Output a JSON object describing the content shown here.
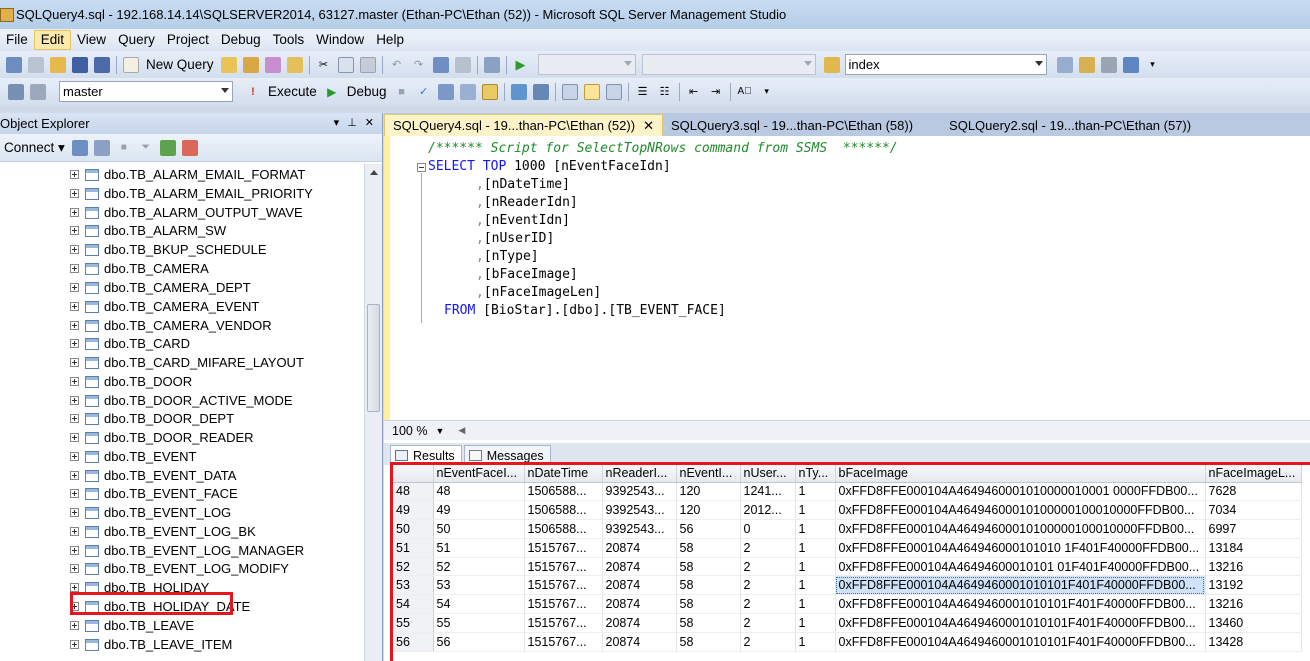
{
  "window": {
    "title": "SQLQuery4.sql - 192.168.14.14\\SQLSERVER2014, 63127.master (Ethan-PC\\Ethan (52)) - Microsoft SQL Server Management Studio"
  },
  "menu": {
    "items": [
      "File",
      "Edit",
      "View",
      "Query",
      "Project",
      "Debug",
      "Tools",
      "Window",
      "Help"
    ],
    "active": "Edit"
  },
  "toolbar1": {
    "new_query_label": "New Query",
    "search_value": "index"
  },
  "toolbar2": {
    "database_value": "master",
    "execute_label": "Execute",
    "debug_label": "Debug"
  },
  "object_explorer": {
    "title": "Object Explorer",
    "pin_glyph": "▾ ⊥ ✕",
    "connect_label": "Connect",
    "items": [
      "dbo.TB_ALARM_EMAIL_FORMAT",
      "dbo.TB_ALARM_EMAIL_PRIORITY",
      "dbo.TB_ALARM_OUTPUT_WAVE",
      "dbo.TB_ALARM_SW",
      "dbo.TB_BKUP_SCHEDULE",
      "dbo.TB_CAMERA",
      "dbo.TB_CAMERA_DEPT",
      "dbo.TB_CAMERA_EVENT",
      "dbo.TB_CAMERA_VENDOR",
      "dbo.TB_CARD",
      "dbo.TB_CARD_MIFARE_LAYOUT",
      "dbo.TB_DOOR",
      "dbo.TB_DOOR_ACTIVE_MODE",
      "dbo.TB_DOOR_DEPT",
      "dbo.TB_DOOR_READER",
      "dbo.TB_EVENT",
      "dbo.TB_EVENT_DATA",
      "dbo.TB_EVENT_FACE",
      "dbo.TB_EVENT_LOG",
      "dbo.TB_EVENT_LOG_BK",
      "dbo.TB_EVENT_LOG_MANAGER",
      "dbo.TB_EVENT_LOG_MODIFY",
      "dbo.TB_HOLIDAY",
      "dbo.TB_HOLIDAY_DATE",
      "dbo.TB_LEAVE",
      "dbo.TB_LEAVE_ITEM"
    ],
    "highlighted_item": "dbo.TB_EVENT_FACE"
  },
  "tabs": [
    {
      "label": "SQLQuery4.sql - 19...than-PC\\Ethan (52))",
      "active": true,
      "close": "✕"
    },
    {
      "label": "SQLQuery3.sql - 19...than-PC\\Ethan (58))",
      "active": false
    },
    {
      "label": "SQLQuery2.sql - 19...than-PC\\Ethan (57))",
      "active": false
    }
  ],
  "editor": {
    "comment": "/****** Script for SelectTopNRows command from SSMS  ******/",
    "select_kw": "SELECT",
    "top_kw": "TOP",
    "top_value": "1000",
    "first_column": "[nEventFaceIdn]",
    "columns": [
      "[nDateTime]",
      "[nReaderIdn]",
      "[nEventIdn]",
      "[nUserID]",
      "[nType]",
      "[bFaceImage]",
      "[nFaceImageLen]"
    ],
    "from_kw": "FROM",
    "from_target": "[BioStar].[dbo].[TB_EVENT_FACE]"
  },
  "zoom": {
    "value": "100 %"
  },
  "results": {
    "tabs": [
      "Results",
      "Messages"
    ],
    "columns": [
      "nEventFaceI...",
      "nDateTime",
      "nReaderI...",
      "nEventI...",
      "nUser...",
      "nTy...",
      "bFaceImage",
      "nFaceImageL..."
    ],
    "rows": [
      {
        "n": "48",
        "cells": [
          "48",
          "1506588...",
          "9392543...",
          "120",
          "1241...",
          "1",
          "0xFFD8FFE000104A4649460001010000010001 0000FFDB00...",
          "7628"
        ]
      },
      {
        "n": "49",
        "cells": [
          "49",
          "1506588...",
          "9392543...",
          "120",
          "2012...",
          "1",
          "0xFFD8FFE000104A46494600010100000100010000FFDB00...",
          "7034"
        ]
      },
      {
        "n": "50",
        "cells": [
          "50",
          "1506588...",
          "9392543...",
          "56",
          "0",
          "1",
          "0xFFD8FFE000104A46494600010100000100010000FFDB00...",
          "6997"
        ]
      },
      {
        "n": "51",
        "cells": [
          "51",
          "1515767...",
          "20874",
          "58",
          "2",
          "1",
          "0xFFD8FFE000104A464946000101010 1F401F40000FFDB00...",
          "13184"
        ]
      },
      {
        "n": "52",
        "cells": [
          "52",
          "1515767...",
          "20874",
          "58",
          "2",
          "1",
          "0xFFD8FFE000104A46494600010101 01F401F40000FFDB00...",
          "13216"
        ]
      },
      {
        "n": "53",
        "cells": [
          "53",
          "1515767...",
          "20874",
          "58",
          "2",
          "1",
          "0xFFD8FFE000104A4649460001010101F401F40000FFDB00...",
          "13192"
        ]
      },
      {
        "n": "54",
        "cells": [
          "54",
          "1515767...",
          "20874",
          "58",
          "2",
          "1",
          "0xFFD8FFE000104A4649460001010101F401F40000FFDB00...",
          "13216"
        ]
      },
      {
        "n": "55",
        "cells": [
          "55",
          "1515767...",
          "20874",
          "58",
          "2",
          "1",
          "0xFFD8FFE000104A4649460001010101F401F40000FFDB00...",
          "13460"
        ]
      },
      {
        "n": "56",
        "cells": [
          "56",
          "1515767...",
          "20874",
          "58",
          "2",
          "1",
          "0xFFD8FFE000104A4649460001010101F401F40000FFDB00...",
          "13428"
        ]
      }
    ],
    "selected_row": "53"
  },
  "colors": {
    "highlight_border": "#e4161e",
    "keyword": "#1414ff",
    "comment": "#1f8a2a",
    "selected_cell": "#cfe2f7"
  }
}
